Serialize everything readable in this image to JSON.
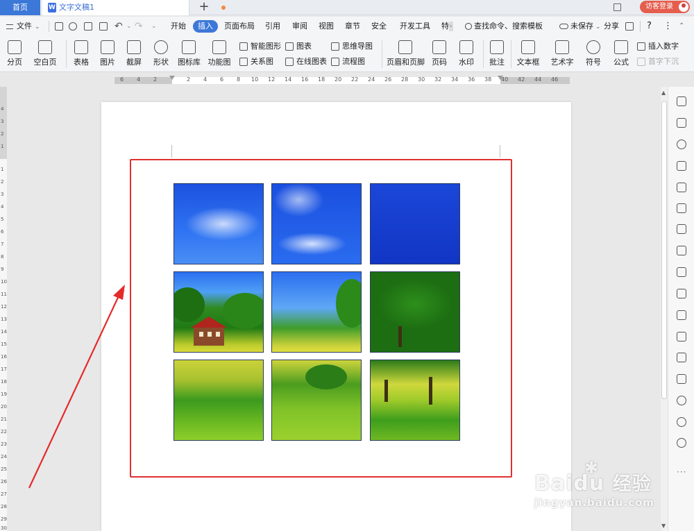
{
  "tabs": {
    "home": "首页",
    "doc_icon": "W",
    "doc_title": "文字文稿1",
    "add": "+"
  },
  "account": {
    "visitor_login": "访客登录"
  },
  "menu": {
    "file": "文件",
    "tabs": [
      "开始",
      "插入",
      "页面布局",
      "引用",
      "审阅",
      "视图",
      "章节",
      "安全",
      "开发工具",
      "特"
    ],
    "active_tab": "插入",
    "search": "查找命令、搜索模板",
    "unsaved": "未保存",
    "share": "分享",
    "help": "?",
    "more": "⋮"
  },
  "ribbon": {
    "large": [
      "分页",
      "空白页",
      "表格",
      "图片",
      "截屏",
      "形状",
      "图标库",
      "功能图",
      "页眉和页脚",
      "页码",
      "水印",
      "批注",
      "文本框",
      "艺术字",
      "符号",
      "公式"
    ],
    "small": {
      "smart_art": "智能图形",
      "chart": "图表",
      "mind_map": "思维导图",
      "relation": "关系图",
      "online_chart": "在线图表",
      "flowchart": "流程图",
      "insert_number": "插入数字",
      "drop_cap": "首字下沉"
    }
  },
  "ruler": {
    "left_labels": [
      "6",
      "4",
      "2"
    ],
    "top_labels": [
      "2",
      "4",
      "6",
      "8",
      "10",
      "12",
      "14",
      "16",
      "18",
      "20",
      "22",
      "24",
      "26",
      "28",
      "30",
      "32",
      "34",
      "36",
      "38",
      "40",
      "42",
      "44",
      "46"
    ],
    "side_labels": [
      "4",
      "3",
      "2",
      "1",
      "1",
      "2",
      "3",
      "4",
      "5",
      "6",
      "7",
      "8",
      "9",
      "10",
      "11",
      "12",
      "13",
      "14",
      "15",
      "16",
      "17",
      "18",
      "19",
      "20",
      "21",
      "22",
      "23",
      "24",
      "25",
      "26",
      "27",
      "28",
      "29",
      "30"
    ]
  },
  "document": {
    "grid_images": [
      "sky-1",
      "sky-2",
      "sky-3",
      "house-hill",
      "forest-sky",
      "tree",
      "meadow-1",
      "meadow-2",
      "meadow-3"
    ],
    "highlight_color": "#e03030",
    "arrow_color": "#e52a2a"
  },
  "watermark": {
    "brand": "Bai",
    "brand2": "du",
    "jingyan": "经验",
    "site": "jingyan.baidu.com"
  },
  "colors": {
    "accent": "#3c78d8",
    "login": "#e55d4d"
  }
}
